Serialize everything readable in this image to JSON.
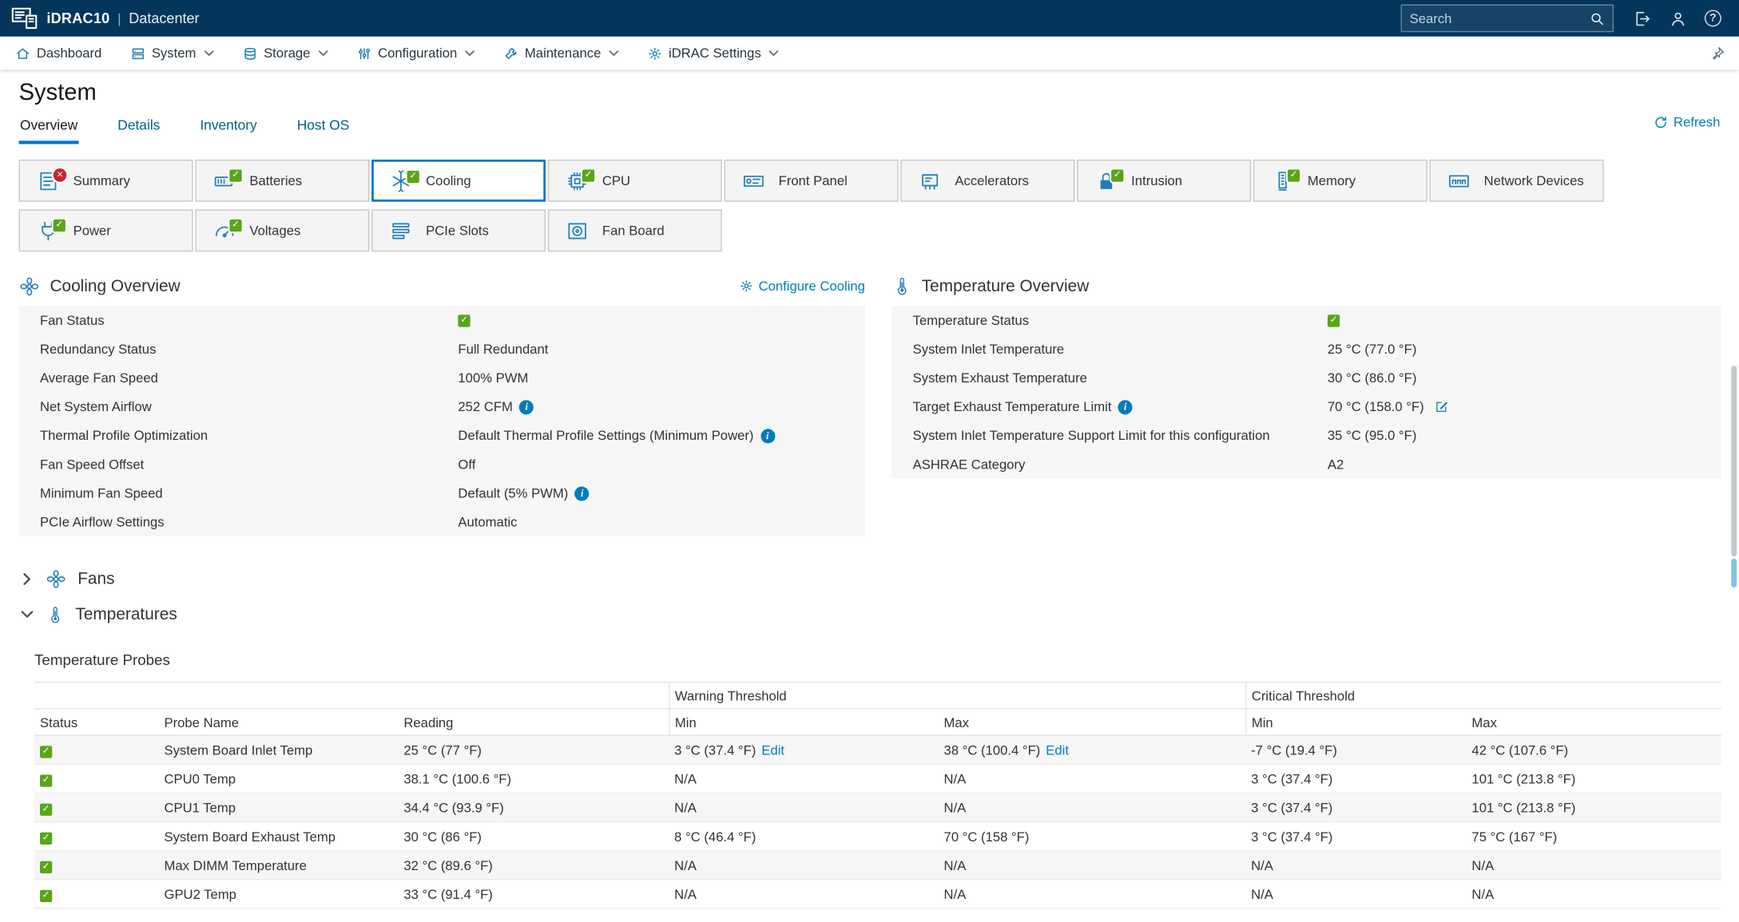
{
  "colors": {
    "topbar_navy": "#04365c",
    "accent_blue": "#0076ce",
    "link_blue": "#007db8",
    "ok_green": "#58a618",
    "error_red": "#c9252c"
  },
  "topbar": {
    "brand": "iDRAC10",
    "brand_divider": "|",
    "license": "Datacenter",
    "search_placeholder": "Search"
  },
  "nav": {
    "items": [
      {
        "label": "Dashboard"
      },
      {
        "label": "System"
      },
      {
        "label": "Storage"
      },
      {
        "label": "Configuration"
      },
      {
        "label": "Maintenance"
      },
      {
        "label": "iDRAC Settings"
      }
    ]
  },
  "page": {
    "title": "System",
    "tabs": [
      {
        "label": "Overview"
      },
      {
        "label": "Details"
      },
      {
        "label": "Inventory"
      },
      {
        "label": "Host OS"
      }
    ],
    "refresh_label": "Refresh"
  },
  "tiles": [
    {
      "label": "Summary",
      "status": "error"
    },
    {
      "label": "Batteries",
      "status": "ok"
    },
    {
      "label": "Cooling",
      "status": "ok",
      "selected": true
    },
    {
      "label": "CPU",
      "status": "ok"
    },
    {
      "label": "Front Panel",
      "status": "none"
    },
    {
      "label": "Accelerators",
      "status": "none"
    },
    {
      "label": "Intrusion",
      "status": "ok"
    },
    {
      "label": "Memory",
      "status": "ok"
    },
    {
      "label": "Network Devices",
      "status": "none"
    },
    {
      "label": "Power",
      "status": "ok"
    },
    {
      "label": "Voltages",
      "status": "ok"
    },
    {
      "label": "PCIe Slots",
      "status": "none"
    },
    {
      "label": "Fan Board",
      "status": "none"
    }
  ],
  "cooling_overview": {
    "title": "Cooling Overview",
    "configure_label": "Configure Cooling",
    "rows": [
      {
        "label": "Fan Status",
        "value": ""
      },
      {
        "label": "Redundancy Status",
        "value": "Full Redundant"
      },
      {
        "label": "Average Fan Speed",
        "value": "100% PWM"
      },
      {
        "label": "Net System Airflow",
        "value": "252 CFM"
      },
      {
        "label": "Thermal Profile Optimization",
        "value": "Default Thermal Profile Settings (Minimum Power)"
      },
      {
        "label": "Fan Speed Offset",
        "value": "Off"
      },
      {
        "label": "Minimum Fan Speed",
        "value": "Default (5% PWM)"
      },
      {
        "label": "PCIe Airflow Settings",
        "value": "Automatic"
      }
    ]
  },
  "temperature_overview": {
    "title": "Temperature Overview",
    "rows": [
      {
        "label": "Temperature Status",
        "value": ""
      },
      {
        "label": "System Inlet Temperature",
        "value": "25 °C (77.0 °F)"
      },
      {
        "label": "System Exhaust Temperature",
        "value": "30 °C (86.0 °F)"
      },
      {
        "label": "Target Exhaust Temperature Limit",
        "value": "70 °C (158.0 °F)"
      },
      {
        "label": "System Inlet Temperature Support Limit for this configuration",
        "value": "35 °C (95.0 °F)"
      },
      {
        "label": "ASHRAE Category",
        "value": "A2"
      }
    ]
  },
  "sections": {
    "fans": {
      "title": "Fans"
    },
    "temperatures": {
      "title": "Temperatures"
    }
  },
  "probes_table": {
    "title": "Temperature Probes",
    "group_headers": [
      "Warning Threshold",
      "Critical Threshold"
    ],
    "columns": [
      "Status",
      "Probe Name",
      "Reading",
      "Min",
      "Max",
      "Min",
      "Max"
    ],
    "edit_label": "Edit",
    "rows": [
      {
        "status": "ok",
        "name": "System Board Inlet Temp",
        "reading": "25 °C (77 °F)",
        "warn_min": "3 °C (37.4 °F)",
        "warn_max": "38 °C (100.4 °F)",
        "crit_min": "-7 °C (19.4 °F)",
        "crit_max": "42 °C (107.6 °F)"
      },
      {
        "status": "ok",
        "name": "CPU0 Temp",
        "reading": "38.1 °C (100.6 °F)",
        "warn_min": "N/A",
        "warn_max": "N/A",
        "crit_min": "3 °C (37.4 °F)",
        "crit_max": "101 °C (213.8 °F)"
      },
      {
        "status": "ok",
        "name": "CPU1 Temp",
        "reading": "34.4 °C (93.9 °F)",
        "warn_min": "N/A",
        "warn_max": "N/A",
        "crit_min": "3 °C (37.4 °F)",
        "crit_max": "101 °C (213.8 °F)"
      },
      {
        "status": "ok",
        "name": "System Board Exhaust Temp",
        "reading": "30 °C (86 °F)",
        "warn_min": "8 °C (46.4 °F)",
        "warn_max": "70 °C (158 °F)",
        "crit_min": "3 °C (37.4 °F)",
        "crit_max": "75 °C (167 °F)"
      },
      {
        "status": "ok",
        "name": "Max DIMM Temperature",
        "reading": "32 °C (89.6 °F)",
        "warn_min": "N/A",
        "warn_max": "N/A",
        "crit_min": "N/A",
        "crit_max": "N/A"
      },
      {
        "status": "ok",
        "name": "GPU2 Temp",
        "reading": "33 °C (91.4 °F)",
        "warn_min": "N/A",
        "warn_max": "N/A",
        "crit_min": "N/A",
        "crit_max": "N/A"
      }
    ]
  }
}
